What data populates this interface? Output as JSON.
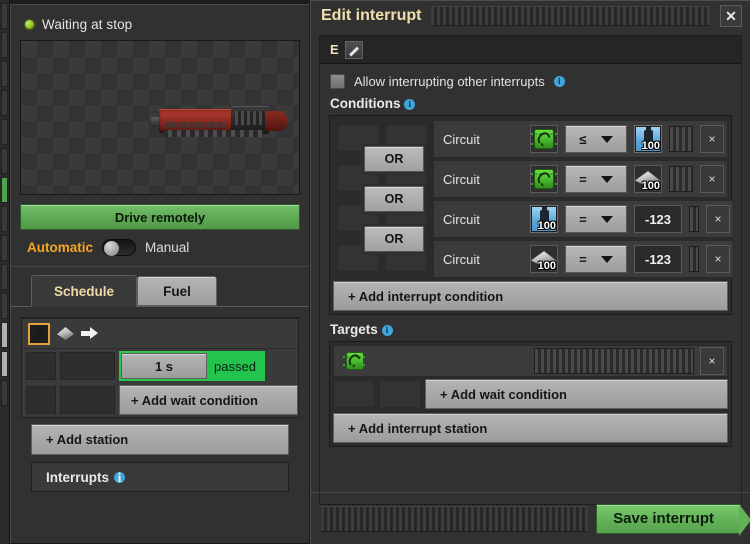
{
  "train_panel": {
    "status": "Waiting at stop",
    "status_color": "#8fc423",
    "drive_button": "Drive remotely",
    "mode_auto": "Automatic",
    "mode_manual": "Manual",
    "tabs": [
      {
        "label": "Schedule",
        "active": true
      },
      {
        "label": "Fuel",
        "active": false
      }
    ],
    "schedule": {
      "entry_icons": [
        "station-icon",
        "stone-rhombus-icon",
        "arrow-right-icon"
      ],
      "wait_condition": {
        "value": "1 s",
        "state": "passed"
      },
      "add_wait_condition": "+ Add wait condition",
      "add_station": "+ Add station",
      "interrupts_label": "Interrupts"
    }
  },
  "dialog": {
    "title": "Edit interrupt",
    "close_label": "✕",
    "name": "E",
    "allow_interrupting_label": "Allow interrupting other interrupts",
    "allow_interrupting_checked": false,
    "conditions_label": "Conditions",
    "or_label": "OR",
    "conditions": [
      {
        "type": "Circuit",
        "signal_icon": "electronic-circuit-icon",
        "signal_count": "",
        "operator": "≤",
        "right_icon": "fluid-signal-icon",
        "right_count": "100",
        "right_kind": "signal"
      },
      {
        "type": "Circuit",
        "signal_icon": "electronic-circuit-icon",
        "signal_count": "",
        "operator": "=",
        "right_icon": "stone-signal-icon",
        "right_count": "100",
        "right_kind": "signal"
      },
      {
        "type": "Circuit",
        "signal_icon": "fluid-signal-icon",
        "signal_count": "100",
        "operator": "=",
        "right_icon": "",
        "right_count": "-123",
        "right_kind": "constant"
      },
      {
        "type": "Circuit",
        "signal_icon": "stone-signal-icon",
        "signal_count": "100",
        "operator": "=",
        "right_icon": "",
        "right_count": "-123",
        "right_kind": "constant"
      }
    ],
    "add_interrupt_condition": "+ Add interrupt condition",
    "targets_label": "Targets",
    "target_signal_icon": "electronic-circuit-icon",
    "target_add_wait_condition": "+ Add wait condition",
    "add_interrupt_station": "+ Add interrupt station",
    "save_button": "Save interrupt",
    "remove_label": "×",
    "accent_green": "#62b257",
    "accent_title": "#f3dfb0"
  }
}
